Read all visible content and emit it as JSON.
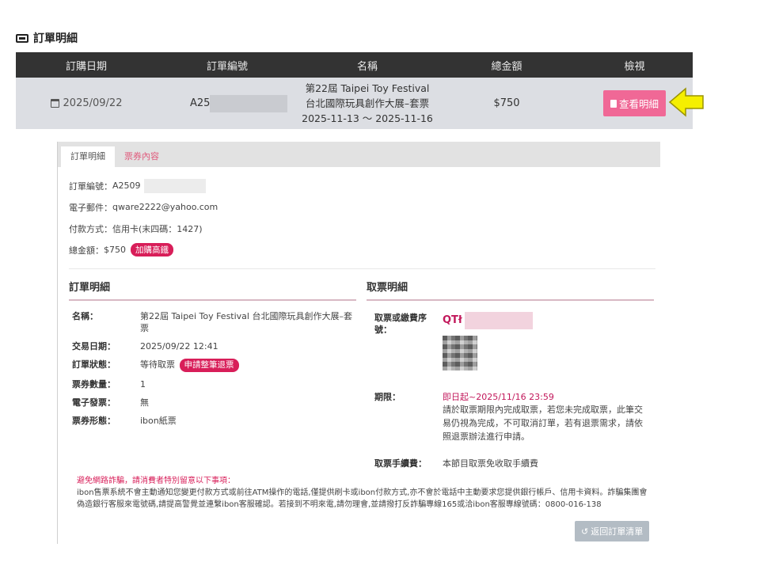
{
  "page": {
    "title": "訂單明細",
    "title_icon": "ticket-icon"
  },
  "order_table": {
    "headers": [
      "訂購日期",
      "訂單編號",
      "名稱",
      "總金額",
      "檢視"
    ],
    "row": {
      "date": "2025/09/22",
      "order_no": "A25",
      "name_line1": "第22屆 Taipei Toy Festival",
      "name_line2": "台北國際玩具創作大展–套票",
      "name_line3": "2025-11-13 ～ 2025-11-16",
      "amount": "$750",
      "view_button": "查看明細"
    }
  },
  "tabs": [
    "訂單明細",
    "票券內容"
  ],
  "summary": {
    "order_no_label": "訂單編號：",
    "order_no": "A2509",
    "email_label": "電子郵件：",
    "email": "qware2222@yahoo.com",
    "payment_label": "付款方式：",
    "payment": "信用卡(末四碼：1427)",
    "total_label": "總金額：",
    "total": "$750",
    "addon_badge": "加購高鐵"
  },
  "order_detail": {
    "title": "訂單明細",
    "name_label": "名稱：",
    "name": "第22屆 Taipei Toy Festival 台北國際玩具創作大展–套票",
    "trade_date_label": "交易日期：",
    "trade_date": "2025/09/22 12:41",
    "status_label": "訂單狀態：",
    "status": "等待取票",
    "refund_badge": "申請整筆退票",
    "quantity_label": "票券數量：",
    "quantity": "1",
    "invoice_label": "電子發票：",
    "invoice": "無",
    "ticket_type_label": "票券形態：",
    "ticket_type": "ibon紙票"
  },
  "pickup_detail": {
    "title": "取票明細",
    "code_label": "取票或繳費序號：",
    "code_prefix": "QTł",
    "deadline_label": "期限：",
    "deadline": "即日起~2025/11/16 23:59",
    "deadline_note": "請於取票期限內完成取票，若您未完成取票，此筆交易仍視為完成，不可取消訂單，若有退票需求，請依照退票辦法進行申請。",
    "fee_label": "取票手續費：",
    "fee": "本節目取票免收取手續費"
  },
  "warning": {
    "title": "避免網路詐騙，請消費者特別留意以下事項：",
    "text": "ibon售票系統不會主動通知您變更付款方式或前往ATM操作的電話,僅提供刷卡或ibon付款方式,亦不會於電話中主動要求您提供銀行帳戶、信用卡資料。詐騙集團會偽造銀行客服來電號碼,請提高警覺並連繫ibon客服確認。若接到不明來電,請勿理會,並請撥打反詐騙專線165或洽ibon客服專線號碼：0800-016-138"
  },
  "back_button": "返回訂單清單",
  "colors": {
    "header_bg": "#333333",
    "row_bg": "#dcdee3",
    "accent_pink": "#f06896",
    "badge_red": "#d81e59",
    "arrow_yellow": "#f5ef00"
  }
}
